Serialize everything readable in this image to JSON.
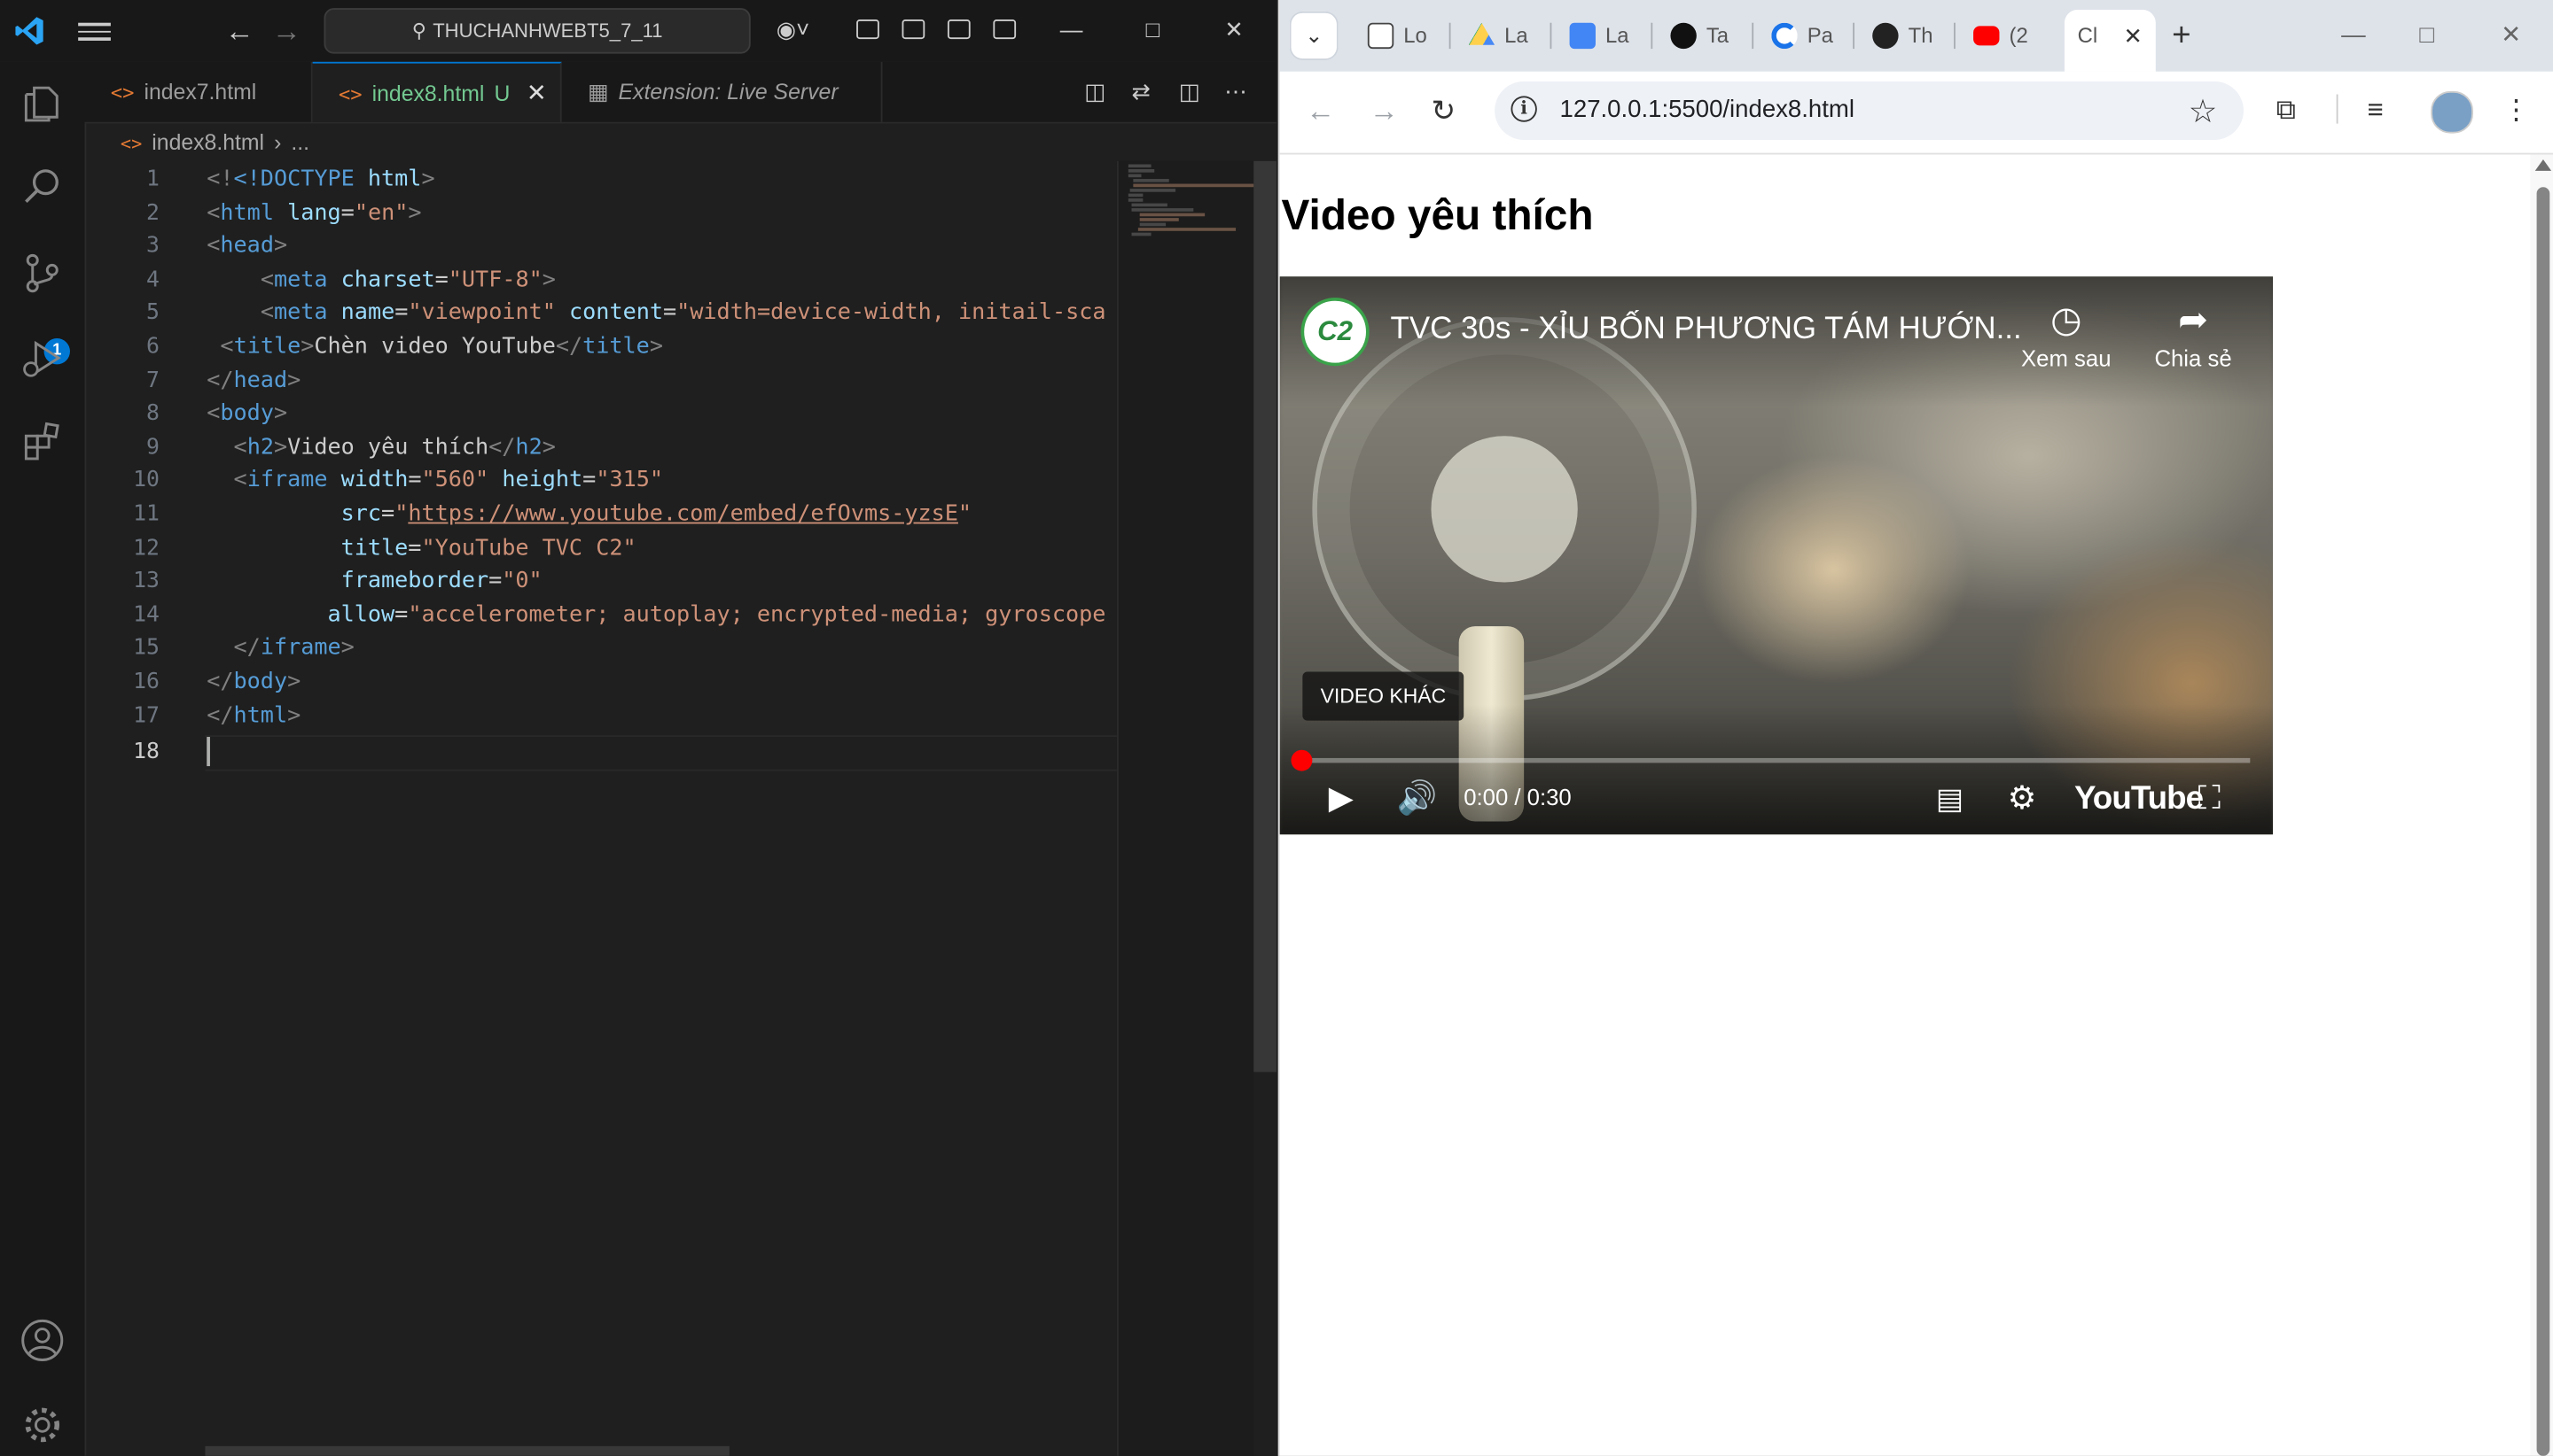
{
  "vscode": {
    "search_text": "THUCHANHWEBT5_7_11",
    "tabs": [
      {
        "label": "index7.html"
      },
      {
        "label": "index8.html",
        "modified": "U"
      },
      {
        "label": "Extension: Live Server"
      }
    ],
    "breadcrumb_file": "index8.html",
    "breadcrumb_more": "...",
    "scm_badge": "1",
    "line_numbers": [
      "1",
      "2",
      "3",
      "4",
      "5",
      "6",
      "7",
      "8",
      "9",
      "10",
      "11",
      "12",
      "13",
      "14",
      "15",
      "16",
      "17",
      "18"
    ],
    "code": {
      "l1_doctype": "<!DOCTYPE",
      "l1_html": " html",
      "l1_close": ">",
      "l2_tag": "html",
      "l2_attr": "lang",
      "l2_val": "\"en\"",
      "l3_tag": "head",
      "l4_tag": "meta",
      "l4_attr": "charset",
      "l4_val": "\"UTF-8\"",
      "l5_tag": "meta",
      "l5_attr1": "name",
      "l5_val1": "\"viewpoint\"",
      "l5_attr2": "content",
      "l5_val2": "\"width=device-width, initail-sca",
      "l6_tag": "title",
      "l6_text": "Chèn video YouTube",
      "l7_tag": "head",
      "l8_tag": "body",
      "l9_tag": "h2",
      "l9_text": "Video yêu thích",
      "l10_tag": "iframe",
      "l10_attr1": "width",
      "l10_val1": "\"560\"",
      "l10_attr2": "height",
      "l10_val2": "\"315\"",
      "l11_attr": "src",
      "l11_val": "https://www.youtube.com/embed/efOvms-yzsE",
      "l12_attr": "title",
      "l12_val": "\"YouTube TVC C2\"",
      "l13_attr": "frameborder",
      "l13_val": "\"0\"",
      "l14_attr": "allow",
      "l14_val": "\"accelerometer; autoplay; encrypted-media; gyroscope",
      "l15_tag": "iframe",
      "l16_tag": "body",
      "l17_tag": "html"
    }
  },
  "chrome": {
    "tabs": [
      {
        "label": "Lo",
        "favicon": "photos-icon"
      },
      {
        "label": "La",
        "favicon": "drive-icon"
      },
      {
        "label": "La",
        "favicon": "docs-icon"
      },
      {
        "label": "Ta",
        "favicon": "chatgpt-icon"
      },
      {
        "label": "Pa",
        "favicon": "c-icon"
      },
      {
        "label": "Th",
        "favicon": "github-icon"
      },
      {
        "label": "(2",
        "favicon": "youtube-icon"
      },
      {
        "label": "Cl",
        "favicon": "none",
        "active": true
      }
    ],
    "url": "127.0.0.1:5500/index8.html",
    "page": {
      "heading": "Video yêu thích",
      "video": {
        "channel_logo": "C2",
        "title": "TVC 30s - XỈU BỐN PHƯƠNG TÁM HƯỚN...",
        "watch_later": "Xem sau",
        "share": "Chia sẻ",
        "more_videos": "VIDEO KHÁC",
        "time": "0:00 / 0:30",
        "brand": "YouTube",
        "progress": 0
      }
    }
  },
  "colors": {
    "vscode_bg": "#1f1f1f",
    "accent": "#0078d4",
    "tag": "#569cd6",
    "attr": "#9cdcfe",
    "string": "#ce9178",
    "progress_dot": "#ff0000"
  }
}
